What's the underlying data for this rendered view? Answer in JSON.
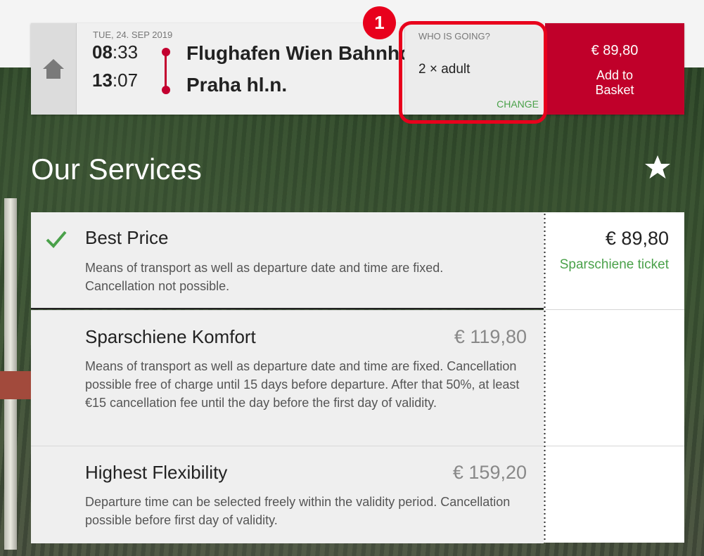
{
  "header": {
    "date": "TUE, 24. SEP 2019",
    "departure": {
      "hour": "08",
      "min": ":33",
      "station": "Flughafen Wien Bahnhof"
    },
    "arrival": {
      "hour": "13",
      "min": ":07",
      "station": "Praha hl.n."
    },
    "who": {
      "label": "WHO IS GOING?",
      "value": "2 × adult",
      "change": "CHANGE"
    },
    "basket": {
      "price": "€ 89,80",
      "label": "Add to Basket"
    }
  },
  "annotation": {
    "number": "1"
  },
  "services": {
    "title": "Our Services",
    "items": [
      {
        "title": "Best Price",
        "price": "",
        "desc": "Means of transport as well as departure date and time are fixed.\nCancellation not possible.",
        "selected": true
      },
      {
        "title": "Sparschiene Komfort",
        "price": "€ 119,80",
        "desc": "Means of transport as well as departure date and time are fixed. Cancellation possible free of charge until 15 days before departure. After that 50%, at least €15 cancellation fee until the day before the first day of validity."
      },
      {
        "title": "Highest Flexibility",
        "price": "€ 159,20",
        "desc": "Departure time can be selected freely within the validity period. Cancellation possible before first day of validity."
      }
    ],
    "selected_price": "€ 89,80",
    "selected_ticket": "Sparschiene ticket"
  },
  "colors": {
    "brand_red": "#c0002a",
    "accent_green": "#4aa14a",
    "annotation_red": "#e8001c"
  }
}
